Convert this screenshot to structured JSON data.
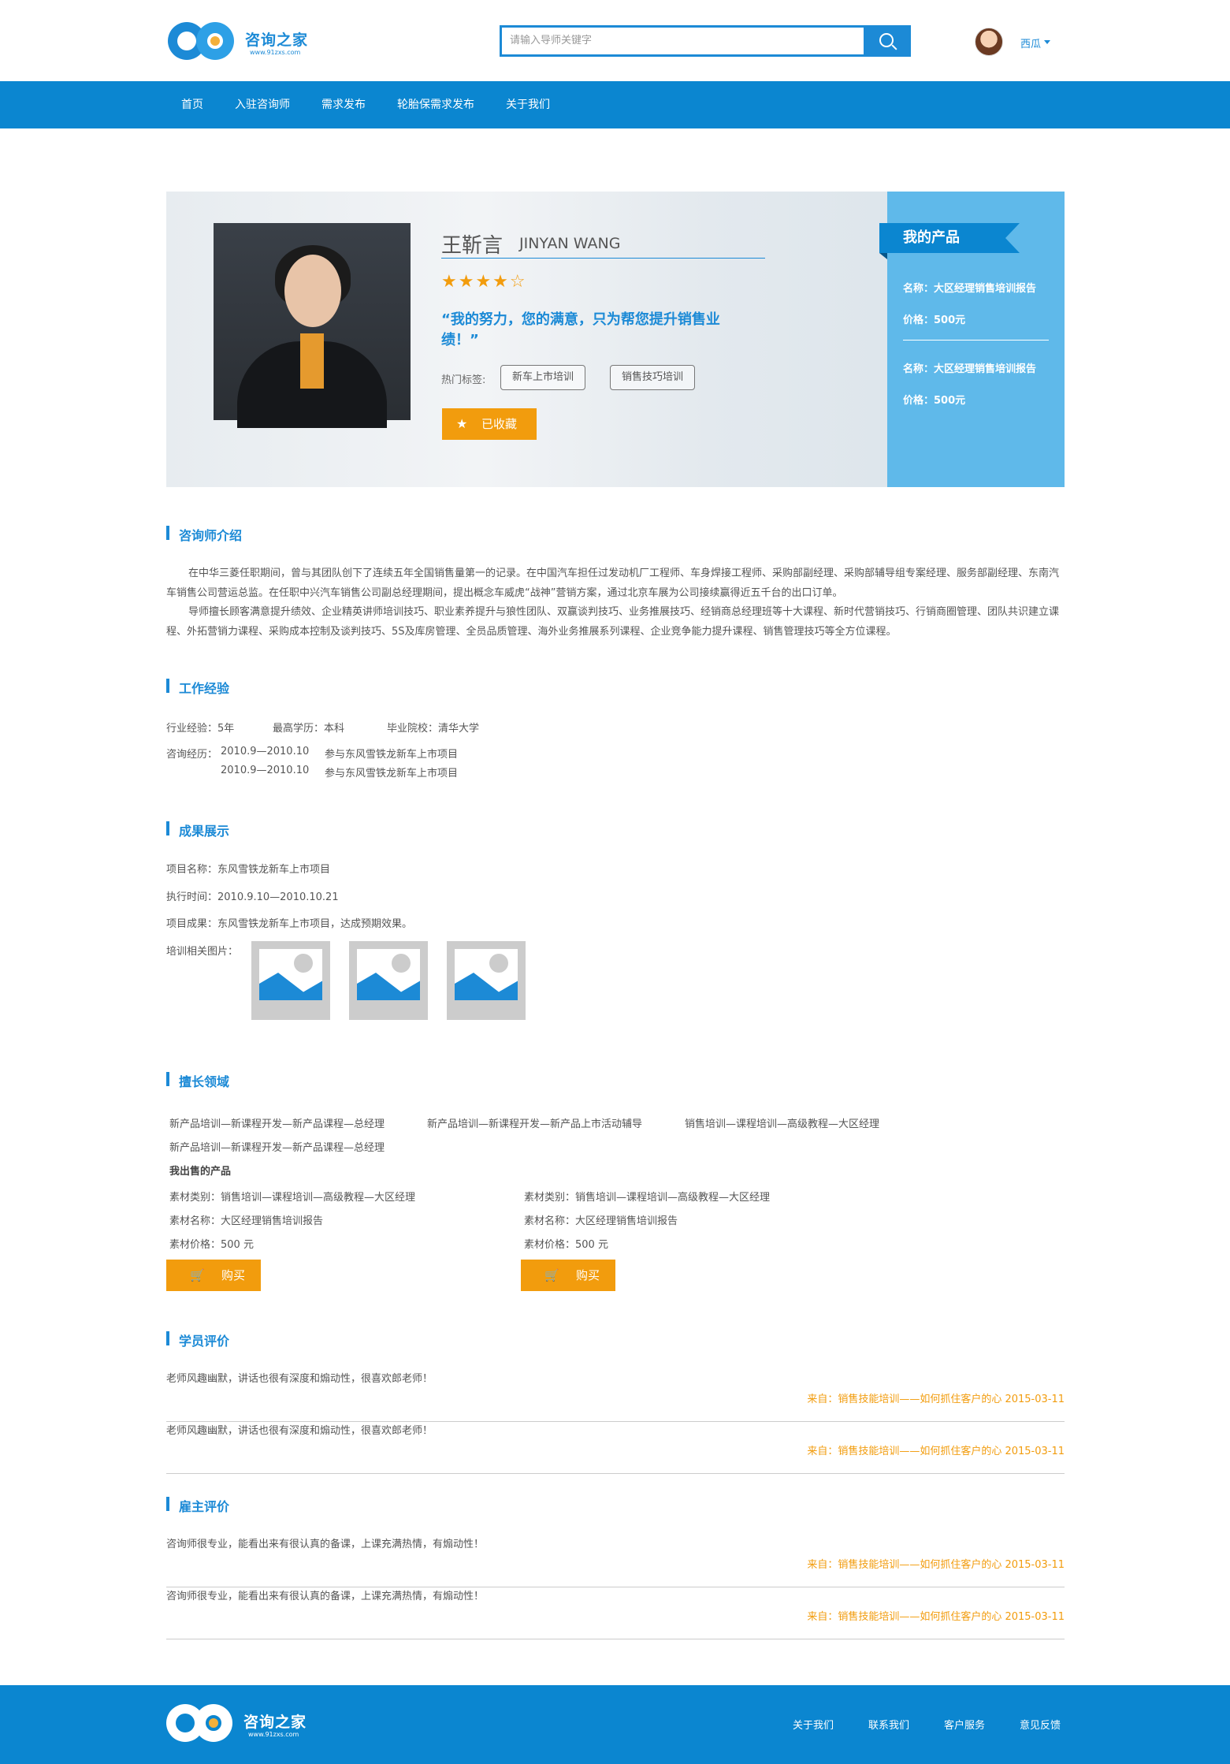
{
  "header": {
    "logo_text": "咨询之家",
    "logo_url": "www.91zxs.com",
    "search_placeholder": "请输入导师关键字",
    "user_name": "西瓜"
  },
  "nav": [
    "首页",
    "入驻咨询师",
    "需求发布",
    "轮胎保需求发布",
    "关于我们"
  ],
  "profile": {
    "name": "王靳言",
    "english_name": "JINYAN WANG",
    "rating_stars": "★★★★☆",
    "rating": 4,
    "rating_max": 5,
    "motto": "“我的努力，您的满意，只为帮您提升销售业绩！”",
    "tags_label": "热门标签:",
    "tags": [
      "新车上市培训",
      "销售技巧培训"
    ],
    "favorite_label": "已收藏"
  },
  "products_panel": {
    "title": "我的产品",
    "items": [
      {
        "name": "名称：大区经理销售培训报告",
        "price": "价格：500元"
      },
      {
        "name": "名称：大区经理销售培训报告",
        "price": "价格：500元"
      }
    ]
  },
  "intro": {
    "title": "咨询师介绍",
    "p1": "在中华三菱任职期间，曾与其团队创下了连续五年全国销售量第一的记录。在中国汽车担任过发动机厂工程师、车身焊接工程师、采购部副经理、采购部辅导组专案经理、服务部副经理、东南汽车销售公司营运总监。在任职中兴汽车销售公司副总经理期间，提出概念车威虎“战神”营销方案，通过北京车展为公司接续赢得近五千台的出口订单。",
    "p2": "导师擅长顾客满意提升绩效、企业精英讲师培训技巧、职业素养提升与狼性团队、双赢谈判技巧、业务推展技巧、经销商总经理班等十大课程、新时代营销技巧、行销商圈管理、团队共识建立课程、外拓营销力课程、采购成本控制及谈判技巧、5S及库房管理、全员品质管理、海外业务推展系列课程、企业竞争能力提升课程、销售管理技巧等全方位课程。"
  },
  "experience": {
    "title": "工作经验",
    "industry": "行业经验：5年",
    "education": "最高学历：本科",
    "school": "毕业院校：清华大学",
    "history_label": "咨询经历：",
    "history": [
      {
        "period": "2010.9—2010.10",
        "desc": "参与东风雪铁龙新车上市项目"
      },
      {
        "period": "2010.9—2010.10",
        "desc": "参与东风雪铁龙新车上市项目"
      }
    ]
  },
  "results": {
    "title": "成果展示",
    "project": "项目名称：东风雪铁龙新车上市项目",
    "time": "执行时间：2010.9.10—2010.10.21",
    "outcome": "项目成果：东风雪铁龙新车上市项目，达成预期效果。",
    "images_label": "培训相关图片："
  },
  "expertise": {
    "title": "擅长领域",
    "items": [
      "新产品培训—新课程开发—新产品课程—总经理",
      "新产品培训—新课程开发—新产品上市活动辅导",
      "销售培训—课程培训—高级教程—大区经理",
      "新产品培训—新课程开发—新产品课程—总经理"
    ],
    "sold_title": "我出售的产品",
    "sold": [
      {
        "type": "素材类别：销售培训—课程培训—高级教程—大区经理",
        "name": "素材名称：大区经理销售培训报告",
        "price": "素材价格：500 元",
        "buy": "购买"
      },
      {
        "type": "素材类别：销售培训—课程培训—高级教程—大区经理",
        "name": "素材名称：大区经理销售培训报告",
        "price": "素材价格：500 元",
        "buy": "购买"
      }
    ]
  },
  "student_reviews": {
    "title": "学员评价",
    "items": [
      {
        "text": "老师风趣幽默，讲话也很有深度和煽动性，很喜欢郎老师！",
        "source": "来自：销售技能培训——如何抓住客户的心 2015-03-11"
      },
      {
        "text": "老师风趣幽默，讲话也很有深度和煽动性，很喜欢郎老师！",
        "source": "来自：销售技能培训——如何抓住客户的心 2015-03-11"
      }
    ]
  },
  "employer_reviews": {
    "title": "雇主评价",
    "items": [
      {
        "text": "咨询师很专业，能看出来有很认真的备课，上课充满热情，有煽动性！",
        "source": "来自：销售技能培训——如何抓住客户的心 2015-03-11"
      },
      {
        "text": "咨询师很专业，能看出来有很认真的备课，上课充满热情，有煽动性！",
        "source": "来自：销售技能培训——如何抓住客户的心 2015-03-11"
      }
    ]
  },
  "footer": {
    "logo_text": "咨询之家",
    "logo_url": "www.91zxs.com",
    "links": [
      "关于我们",
      "联系我们",
      "客户服务",
      "意见反馈"
    ]
  },
  "colors": {
    "primary": "#0b86d0",
    "accent": "#f29c0d",
    "panel": "#5fb9ea"
  }
}
